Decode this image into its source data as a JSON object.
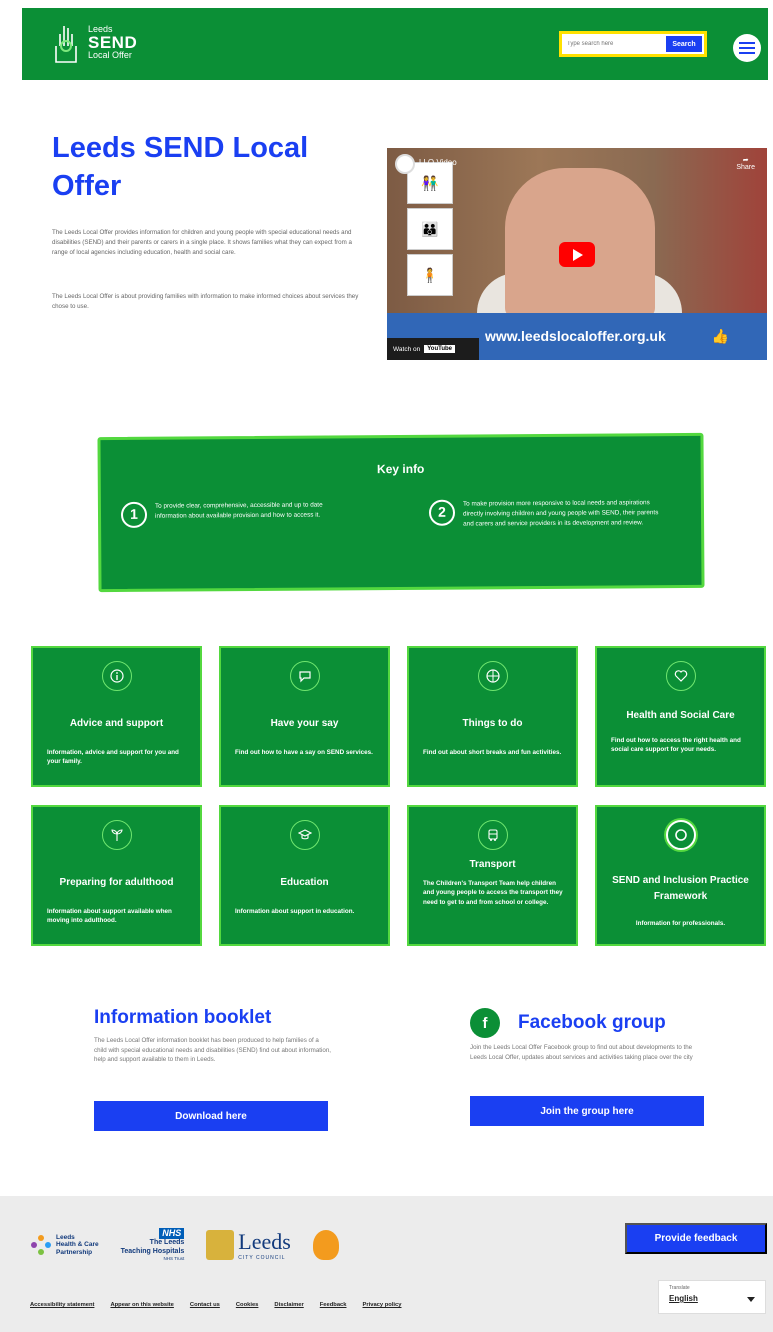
{
  "header": {
    "logo": {
      "line1": "Leeds",
      "line2": "SEND",
      "line3": "Local Offer"
    },
    "search": {
      "placeholder": "Type search here",
      "button": "Search"
    }
  },
  "hero": {
    "title": "Leeds SEND Local Offer",
    "paragraphs": [
      "The Leeds Local Offer provides information for children and young people with special educational needs and disabilities (SEND) and their parents or carers in a single place. It shows families what they can expect from a range of local agencies including education, health and social care.",
      "The Leeds Local Offer is about providing families with information to make informed choices about services they chose to use."
    ],
    "video": {
      "title": "LLO Video",
      "share": "Share",
      "url_banner": "www.leedslocaloffer.org.uk",
      "watch_on": "Watch on",
      "youtube": "YouTube"
    }
  },
  "key_info": {
    "title": "Key info",
    "items": [
      {
        "num": "1",
        "text": "To provide clear, comprehensive, accessible and up to date information about available provision and how to access it."
      },
      {
        "num": "2",
        "text": "To make provision more responsive to local needs and aspirations directly involving children and young people with SEND, their parents and carers and service providers in its development and review."
      }
    ]
  },
  "tiles": [
    {
      "title": "Advice and support",
      "desc": "Information, advice and support for you and your family.",
      "icon": "info-icon"
    },
    {
      "title": "Have your say",
      "desc": "Find out how to have a say on SEND services.",
      "icon": "speech-bubble-icon"
    },
    {
      "title": "Things to do",
      "desc": "Find out about short breaks and fun activities.",
      "icon": "ball-icon"
    },
    {
      "title": "Health and Social Care",
      "desc": "Find out how to access the right health and social care support for your needs.",
      "icon": "heart-icon"
    },
    {
      "title": "Preparing for adulthood",
      "desc": "Information about support available when moving into adulthood.",
      "icon": "sprout-icon"
    },
    {
      "title": "Education",
      "desc": "Information about support in education.",
      "icon": "graduation-cap-icon"
    },
    {
      "title": "Transport",
      "desc": "The Children's Transport Team help children and young people to access the transport they need to get to and from school or college.",
      "icon": "bus-icon"
    },
    {
      "title": "SEND and Inclusion Practice Framework",
      "desc": "Information for professionals.",
      "icon": "target-icon"
    }
  ],
  "booklet": {
    "title": "Information booklet",
    "text": "The Leeds Local Offer information booklet has been produced to help families of a child with special educational needs and disabilities (SEND) find out about information, help and support available to them in Leeds.",
    "button": "Download here"
  },
  "facebook": {
    "icon_letter": "f",
    "title": "Facebook group",
    "text": "Join the Leeds Local Offer Facebook group to find out about developments to the Leeds Local Offer, updates about services and activities taking place over the city",
    "button": "Join the group here"
  },
  "footer": {
    "partner_logo": {
      "line1": "Leeds",
      "line2": "Health & Care",
      "line3": "Partnership"
    },
    "nhs_logo": {
      "badge": "NHS",
      "line1": "The Leeds",
      "line2": "Teaching Hospitals",
      "line3": "NHS Trust"
    },
    "council_logo": {
      "name": "Leeds",
      "sub": "CITY COUNCIL"
    },
    "feedback_button": "Provide feedback",
    "links": [
      "Accessibility statement",
      "Appear on this website",
      "Contact us",
      "Cookies",
      "Disclaimer",
      "Feedback",
      "Privacy policy"
    ],
    "language": {
      "label": "Translate",
      "value": "English"
    }
  },
  "colors": {
    "brand_green": "#0b8f36",
    "accent_blue": "#1a3ff2",
    "highlight_green": "#53d83f"
  }
}
